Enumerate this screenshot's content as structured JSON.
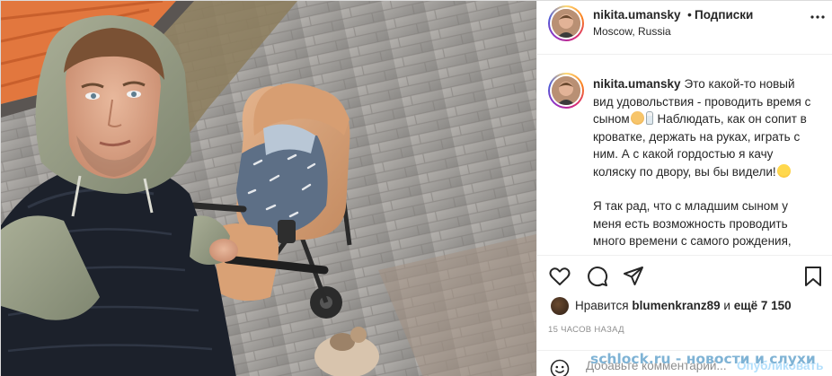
{
  "header": {
    "username": "nikita.umansky",
    "separator": "•",
    "follow_label": "Подписки",
    "location": "Moscow, Russia"
  },
  "caption": {
    "username": "nikita.umansky",
    "para1_a": "Это какой-то новый вид удовольствия - проводить время с сыном",
    "para1_b": " Наблюдать, как он сопит в кроватке, держать на руках, играть с ним. А с какой гордостью я качу коляску по двору, вы бы видели!",
    "para2": "Я так рад, что с младшим сыном у меня есть возможность проводить много времени с самого рождения,"
  },
  "icons": {
    "emoji_1": "baby-emoji-icon",
    "emoji_2": "baby-bottle-emoji-icon",
    "emoji_3": "heart-eyes-emoji-icon",
    "like": "heart-icon",
    "comment": "comment-icon",
    "share": "share-icon",
    "save": "bookmark-icon",
    "more": "more-options-icon",
    "emoji_picker": "smiley-icon"
  },
  "likes": {
    "prefix": "Нравится",
    "user": "blumenkranz89",
    "conj": "и",
    "others": "ещё 7 150"
  },
  "timestamp": "15 ЧАСОВ НАЗАД",
  "comment_box": {
    "placeholder": "Добавьте комментарий...",
    "publish_label": "Опубликовать"
  },
  "watermark": "schlock.ru - новости и слухи",
  "colors": {
    "accent_blue": "#0095f6",
    "publish_disabled": "#b2dffc",
    "watermark": "#7fb3d5"
  }
}
